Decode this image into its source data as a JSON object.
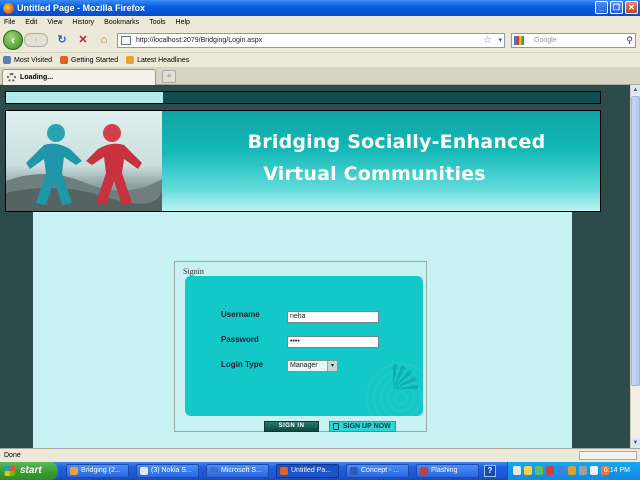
{
  "window": {
    "title": "Untitled Page - Mozilla Firefox",
    "buttons": [
      "_",
      "❐",
      "✕"
    ]
  },
  "menu": [
    "File",
    "Edit",
    "View",
    "History",
    "Bookmarks",
    "Tools",
    "Help"
  ],
  "nav": {
    "back": "‹",
    "forward": "›",
    "reload": "↻",
    "stop": "✕",
    "home": "⌂",
    "url": "http://localhost:2079/Bridging/Login.aspx",
    "star": "☆",
    "dropdown": "▾",
    "search_placeholder": "Google",
    "search_icon": "⚲"
  },
  "bookmarks": [
    {
      "label": "Most Visited",
      "color": "#5a7fb8"
    },
    {
      "label": "Getting Started",
      "color": "#e2631d"
    },
    {
      "label": "Latest Headlines",
      "color": "#e9a23b"
    }
  ],
  "tabs": {
    "active": "Loading...",
    "new_tab": "+"
  },
  "page": {
    "banner_line1": "Bridging Socially-Enhanced",
    "banner_line2": "Virtual Communities",
    "fieldset_legend": "Signin",
    "username_label": "Username",
    "username_value": "neha",
    "password_label": "Password",
    "password_value": "••••",
    "login_type_label": "Login Type",
    "login_type_selected": "Manager",
    "select_arrow": "▾",
    "signin_button": "SIGN IN",
    "signup_button": "SIGN UP NOW"
  },
  "scrollbar": {
    "up": "▲",
    "down": "▼"
  },
  "status": {
    "text": "Done"
  },
  "taskbar": {
    "start": "start",
    "help": "?",
    "tasks": [
      {
        "label": "Bridging (2...",
        "color": "#e9a23b"
      },
      {
        "label": "(3) Nokia S...",
        "color": "#dfe8f6"
      },
      {
        "label": "Microsoft S...",
        "color": "#3c6fd0"
      },
      {
        "label": "Untitled Pa...",
        "color": "#e2631d"
      },
      {
        "label": "Concept - ...",
        "color": "#2e5bb8"
      },
      {
        "label": "Flashing",
        "color": "#c04040"
      }
    ],
    "tray_icon_colors": [
      "#e8e8e8",
      "#ffd040",
      "#60c060",
      "#d04040",
      "#4080e0",
      "#e0a030",
      "#a0a0a0",
      "#f0f0f0",
      "#ff7040"
    ],
    "clock": "6:14 PM"
  }
}
